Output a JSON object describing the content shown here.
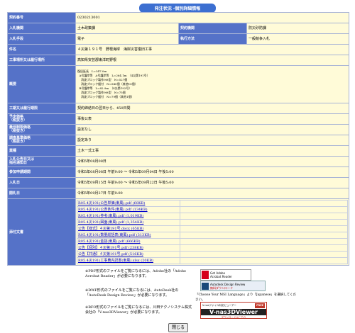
{
  "header": {
    "title": "発注状況 -個別詳細情報"
  },
  "rows": {
    "contract_no": {
      "label": "契約番号",
      "value": "0230213001"
    },
    "agency": {
      "label": "入札機関",
      "value": "土木政策課"
    },
    "category": {
      "label": "契約機関",
      "value": "防災砂防課"
    },
    "method": {
      "label": "入札手段",
      "value": "電子"
    },
    "exec": {
      "label": "執行方法",
      "value": "一般競争入札"
    },
    "name": {
      "label": "件名",
      "value": "４災第１９１号　野根海岸　海岸災害復旧工事"
    },
    "place": {
      "label": "工事場所又は履行場所",
      "value": "高知県安芸郡東洋町野根"
    },
    "overview": {
      "label": "概要",
      "value": "復旧延長　L=347.0m\n  A号護岸等　A号護岸等　L=264.1m　（4災第191号）\n    消波ブロック製作90t型　N=527個\n    消波ブロック据付　N=540個（其他10個）\n  B号護岸等　L=82.9m　（4災第192号）\n    消波ブロック製作90t型　N=75個\n    消波ブロック据付　N=79個（其他1個）"
    },
    "period": {
      "label": "工期又は履行期限",
      "value": "契約締結日の翌日から、450日間"
    },
    "price": {
      "label": "予定価格\n（税抜き）",
      "value": "事後公表"
    },
    "min_price": {
      "label": "最低制限価格\n（税抜き）",
      "value": "設定なし"
    },
    "survey_price": {
      "label": "調査基準価格\n（税抜き）",
      "value": "設定あり"
    },
    "class": {
      "label": "業種",
      "value": "土木一式工事"
    },
    "announce": {
      "label": "入札公告日又は\n指名通知日",
      "value": "令和5年08月08日"
    },
    "apply": {
      "label": "参加申請期間",
      "value": "令和5年08月08日 午前9:00 ～ 令和5年09月04日 午後5:00"
    },
    "bid": {
      "label": "入札日",
      "value": "令和5年09月15日 午前9:00 ～ 令和5年09月22日 午後5:00"
    },
    "open": {
      "label": "開札日",
      "value": "令和5年09月27日 午前9:00"
    },
    "attachments": {
      "label": "添付文書"
    }
  },
  "files": [
    "R05.4災191(公告単価(東風).pdf (68KB)",
    "R05.4災191(公表条件(東風).pdf (134KB)",
    "R05.4災191(参考(東風).pdf (1,019KB)",
    "R05.4災191(図面(東風).pdf (1,354KB)",
    "公告【様式】４災第191号.docx (65KB)",
    "R05.4災191(数量総括表(東風).pdf (313KB)",
    "R05.4災191(金抜(東風).pdf (666KB)",
    "公告【個別】４災第191号.pdf (238KB)",
    "公告【共通】４災第191号.pdf (516KB)",
    "R05.4災191(工事費内訳書(東風).xlsx (20KB)"
  ],
  "notes": {
    "pdf": "※PDF形式のファイルをご覧になるには、Adobe社の「Adobe Acrobat Reader」が必要になります。",
    "dwf": "※DWF形式のファイルをご覧になるには、AutoDesk社の「AutoDesk Design Review」が必要になります。",
    "bfo": "※BFO形式のファイルをご覧になるには、川田テクノシステム株式会社の「V-nas3DViewer」が必要になります。",
    "msi_hint": "「Choose Your MSI Language」より「Japanese」を選択してください。"
  },
  "badges": {
    "adobe_line1": "Get Adobe",
    "adobe_line2": "Acrobat Reader",
    "autodesk_line1": "Autodesk Design Review",
    "autodesk_line2": "無料ダウンロード",
    "vnas_top": "V-nasファイル対応ビューアー",
    "vnas_free": "FREE",
    "vnas_name": "V-nas3DViewer",
    "vnas_sub": "ダウンロードはこちら"
  },
  "close_button": "閉じる",
  "colors": {
    "label_bg": "#5572c8",
    "value_bg": "#fffbd8",
    "title_bg": "#3c6fd1",
    "link": "#0000cc"
  }
}
